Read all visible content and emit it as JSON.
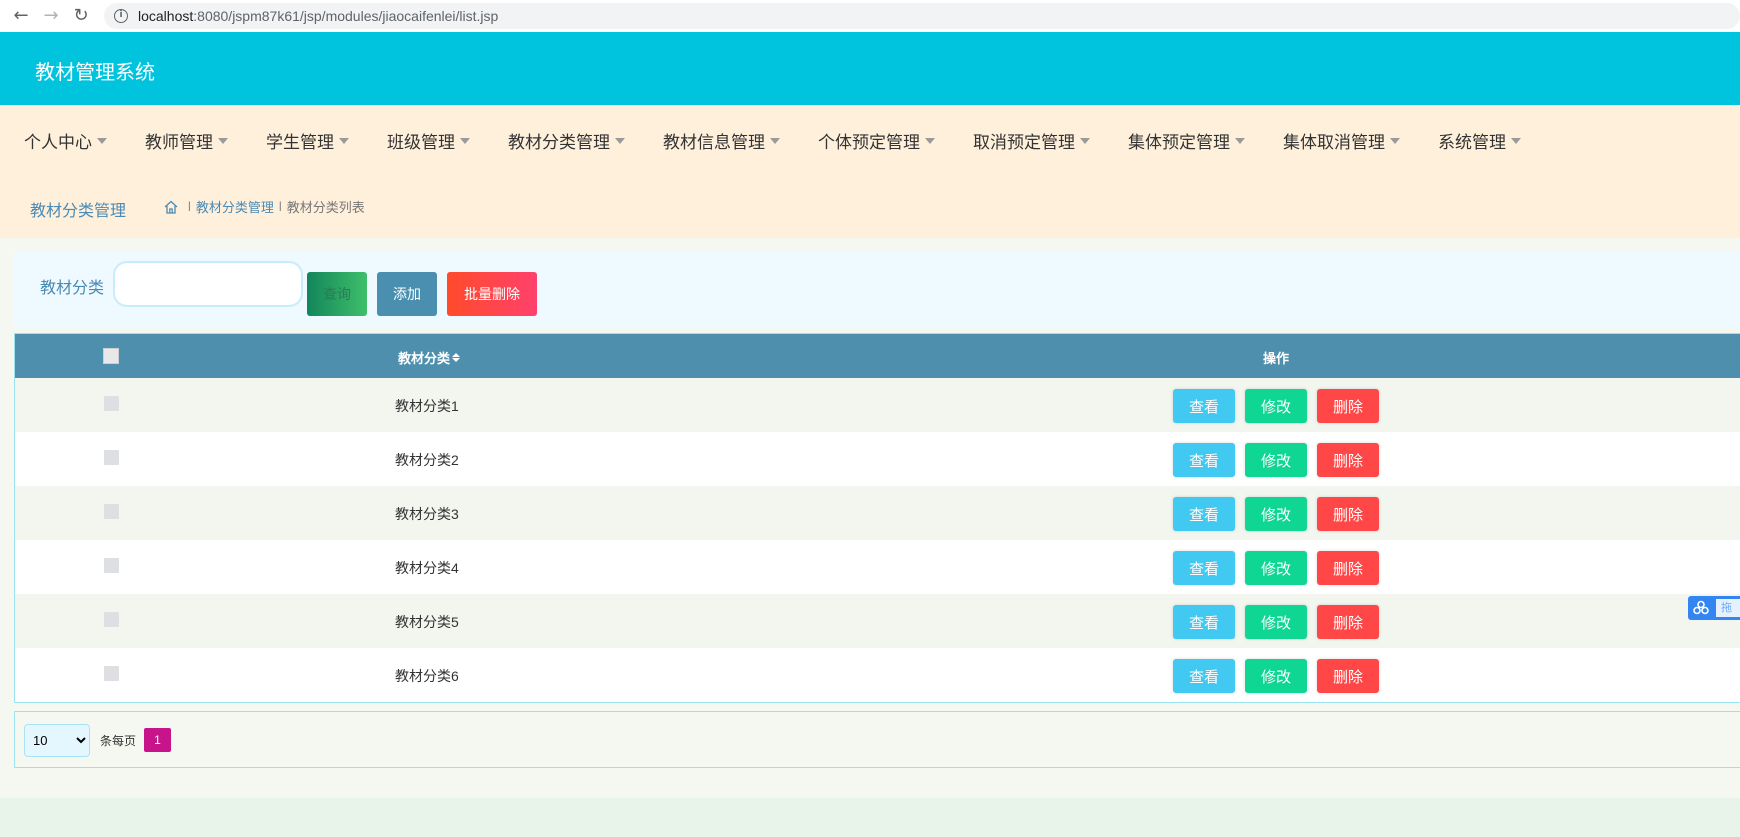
{
  "browser": {
    "back_icon": "arrow-left-icon",
    "forward_icon": "arrow-right-icon",
    "reload_icon": "reload-icon",
    "url_host": "localhost",
    "url_path": ":8080/jspm87k61/jsp/modules/jiaocaifenlei/list.jsp"
  },
  "header": {
    "app_title": "教材管理系统",
    "color": "#00c4de"
  },
  "menu": {
    "items": [
      {
        "label": "个人中心"
      },
      {
        "label": "教师管理"
      },
      {
        "label": "学生管理"
      },
      {
        "label": "班级管理"
      },
      {
        "label": "教材分类管理"
      },
      {
        "label": "教材信息管理"
      },
      {
        "label": "个体预定管理"
      },
      {
        "label": "取消预定管理"
      },
      {
        "label": "集体预定管理"
      },
      {
        "label": "集体取消管理"
      },
      {
        "label": "系统管理"
      }
    ]
  },
  "breadcrumb": {
    "title": "教材分类管理",
    "home_icon": "home-icon",
    "separator": "l",
    "level1": "教材分类管理",
    "level2": "教材分类列表"
  },
  "search": {
    "label": "教材分类",
    "input_value": "",
    "query_button": "查询",
    "add_button": "添加",
    "batch_delete_button": "批量删除"
  },
  "table": {
    "header_name": "教材分类",
    "header_op": "操作",
    "view_label": "查看",
    "edit_label": "修改",
    "delete_label": "删除",
    "rows": [
      {
        "name": "教材分类1"
      },
      {
        "name": "教材分类2"
      },
      {
        "name": "教材分类3"
      },
      {
        "name": "教材分类4"
      },
      {
        "name": "教材分类5"
      },
      {
        "name": "教材分类6"
      }
    ]
  },
  "pagination": {
    "page_size": "10",
    "page_size_options": [
      "10"
    ],
    "per_page_label": "条每页",
    "current_page": "1"
  },
  "float_widget": {
    "icon": "baidu-paw-icon",
    "text": "拖"
  }
}
